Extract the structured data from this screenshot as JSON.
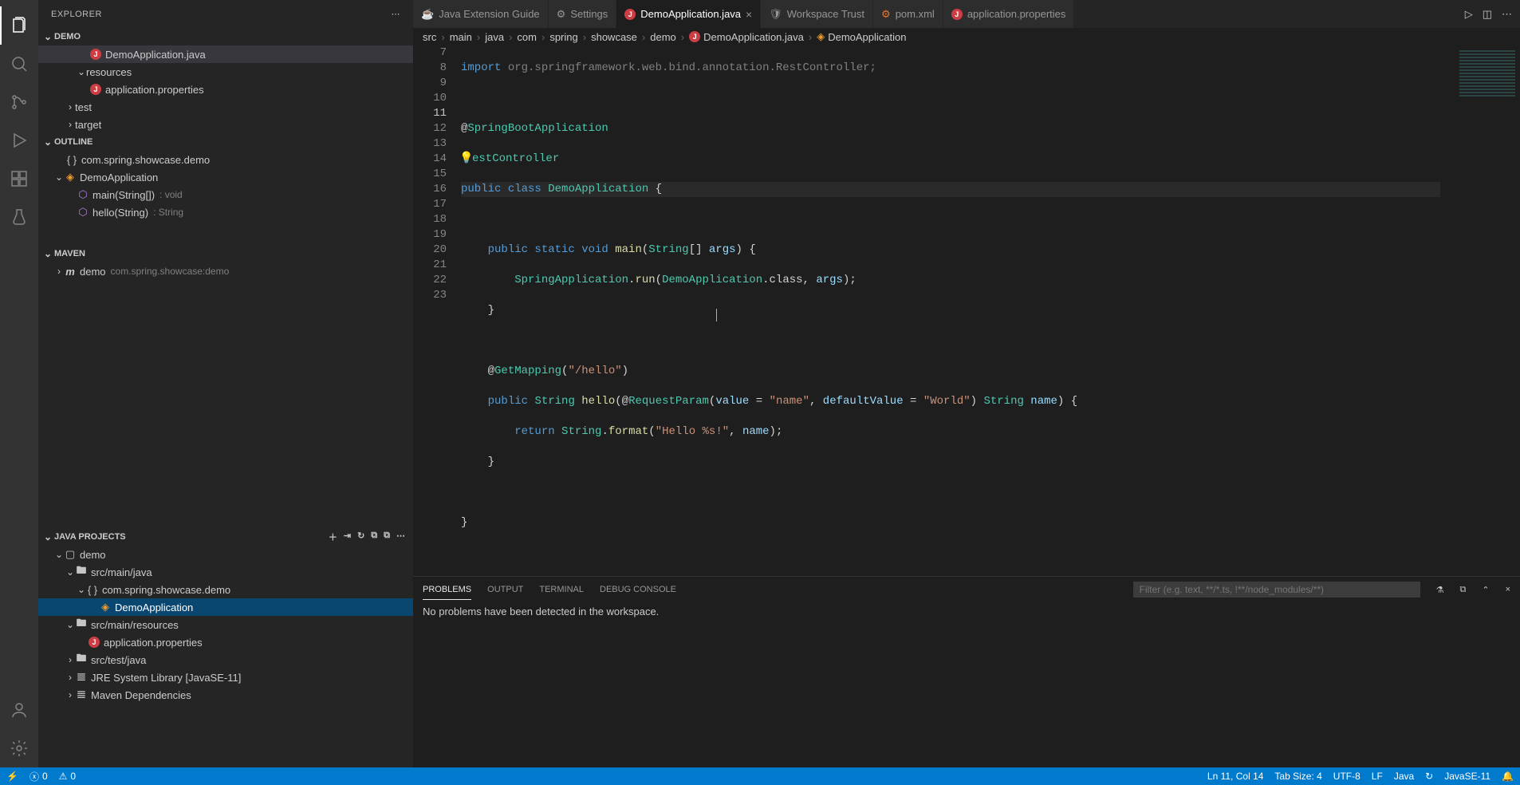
{
  "sidebar": {
    "title": "EXPLORER",
    "sections": {
      "demo": {
        "label": "DEMO",
        "items": [
          {
            "label": "DemoApplication.java",
            "icon": "java"
          },
          {
            "label": "resources",
            "icon": "folder-open"
          },
          {
            "label": "application.properties",
            "icon": "java"
          },
          {
            "label": "test",
            "icon": "folder"
          },
          {
            "label": "target",
            "icon": "folder"
          }
        ]
      },
      "outline": {
        "label": "OUTLINE",
        "items": [
          {
            "label": "com.spring.showcase.demo",
            "icon": "namespace"
          },
          {
            "label": "DemoApplication",
            "icon": "class"
          },
          {
            "label": "main(String[])",
            "hint": ": void",
            "icon": "method"
          },
          {
            "label": "hello(String)",
            "hint": ": String",
            "icon": "method"
          }
        ]
      },
      "maven": {
        "label": "MAVEN",
        "items": [
          {
            "label": "demo",
            "hint": "com.spring.showcase:demo",
            "icon": "maven"
          }
        ]
      },
      "javaProjects": {
        "label": "JAVA PROJECTS",
        "items": [
          {
            "label": "demo",
            "icon": "project"
          },
          {
            "label": "src/main/java",
            "icon": "package-folder"
          },
          {
            "label": "com.spring.showcase.demo",
            "icon": "namespace"
          },
          {
            "label": "DemoApplication",
            "icon": "class",
            "selected": true
          },
          {
            "label": "src/main/resources",
            "icon": "package-folder"
          },
          {
            "label": "application.properties",
            "icon": "java"
          },
          {
            "label": "src/test/java",
            "icon": "package-folder"
          },
          {
            "label": "JRE System Library [JavaSE-11]",
            "icon": "library"
          },
          {
            "label": "Maven Dependencies",
            "icon": "library"
          }
        ]
      }
    }
  },
  "tabs": [
    {
      "label": "Java Extension Guide",
      "icon": "coffee"
    },
    {
      "label": "Settings",
      "icon": "settings"
    },
    {
      "label": "DemoApplication.java",
      "icon": "java",
      "active": true,
      "close": true
    },
    {
      "label": "Workspace Trust",
      "icon": "shield"
    },
    {
      "label": "pom.xml",
      "icon": "xml"
    },
    {
      "label": "application.properties",
      "icon": "java"
    }
  ],
  "breadcrumbs": [
    "src",
    "main",
    "java",
    "com",
    "spring",
    "showcase",
    "demo",
    "DemoApplication.java",
    "DemoApplication"
  ],
  "editor": {
    "startLine": 7,
    "activeLine": 11,
    "cursorText": "|"
  },
  "code": {
    "l7": "import org.springframework.web.bind.annotation.RestController;",
    "l9_at": "@",
    "l9_ann": "SpringBootApplication",
    "l10_at": "@",
    "l10_ann_pre": "R",
    "l10_ann": "estController",
    "l11_kw1": "public",
    "l11_kw2": "class",
    "l11_type": "DemoApplication",
    "l11_brace": " {",
    "l13_kw": "public static void",
    "l13_fn": "main",
    "l13_p1": "(",
    "l13_type": "String",
    "l13_arr": "[] ",
    "l13_var": "args",
    "l13_p2": ") {",
    "l14_type1": "SpringApplication",
    "l14_dot": ".",
    "l14_fn": "run",
    "l14_p1": "(",
    "l14_type2": "DemoApplication",
    "l14_rest": ".class, ",
    "l14_var": "args",
    "l14_end": ");",
    "l15_brace": "    }",
    "l17_at": "    @",
    "l17_ann": "GetMapping",
    "l17_p1": "(",
    "l17_str": "\"/hello\"",
    "l17_p2": ")",
    "l18_kw": "public",
    "l18_ret": "String",
    "l18_fn": "hello",
    "l18_p1": "(@",
    "l18_ann": "RequestParam",
    "l18_p2": "(",
    "l18_var1": "value",
    "l18_eq": " = ",
    "l18_str1": "\"name\"",
    "l18_c": ", ",
    "l18_var2": "defaultValue",
    "l18_eq2": " = ",
    "l18_str2": "\"World\"",
    "l18_p3": ") ",
    "l18_type": "String",
    "l18_sp": " ",
    "l18_var3": "name",
    "l18_end": ") {",
    "l19_kw": "return",
    "l19_type": "String",
    "l19_dot": ".",
    "l19_fn": "format",
    "l19_p1": "(",
    "l19_str": "\"Hello %s!\"",
    "l19_c": ", ",
    "l19_var": "name",
    "l19_end": ");",
    "l20_brace": "    }",
    "l22_brace": "}"
  },
  "panel": {
    "tabs": [
      "PROBLEMS",
      "OUTPUT",
      "TERMINAL",
      "DEBUG CONSOLE"
    ],
    "activeTab": 0,
    "filterPlaceholder": "Filter (e.g. text, **/*.ts, !**/node_modules/**)",
    "message": "No problems have been detected in the workspace."
  },
  "status": {
    "errors": "0",
    "warnings": "0",
    "cursor": "Ln 11, Col 14",
    "tabSize": "Tab Size: 4",
    "encoding": "UTF-8",
    "eol": "LF",
    "language": "Java",
    "jdk": "JavaSE-11"
  }
}
